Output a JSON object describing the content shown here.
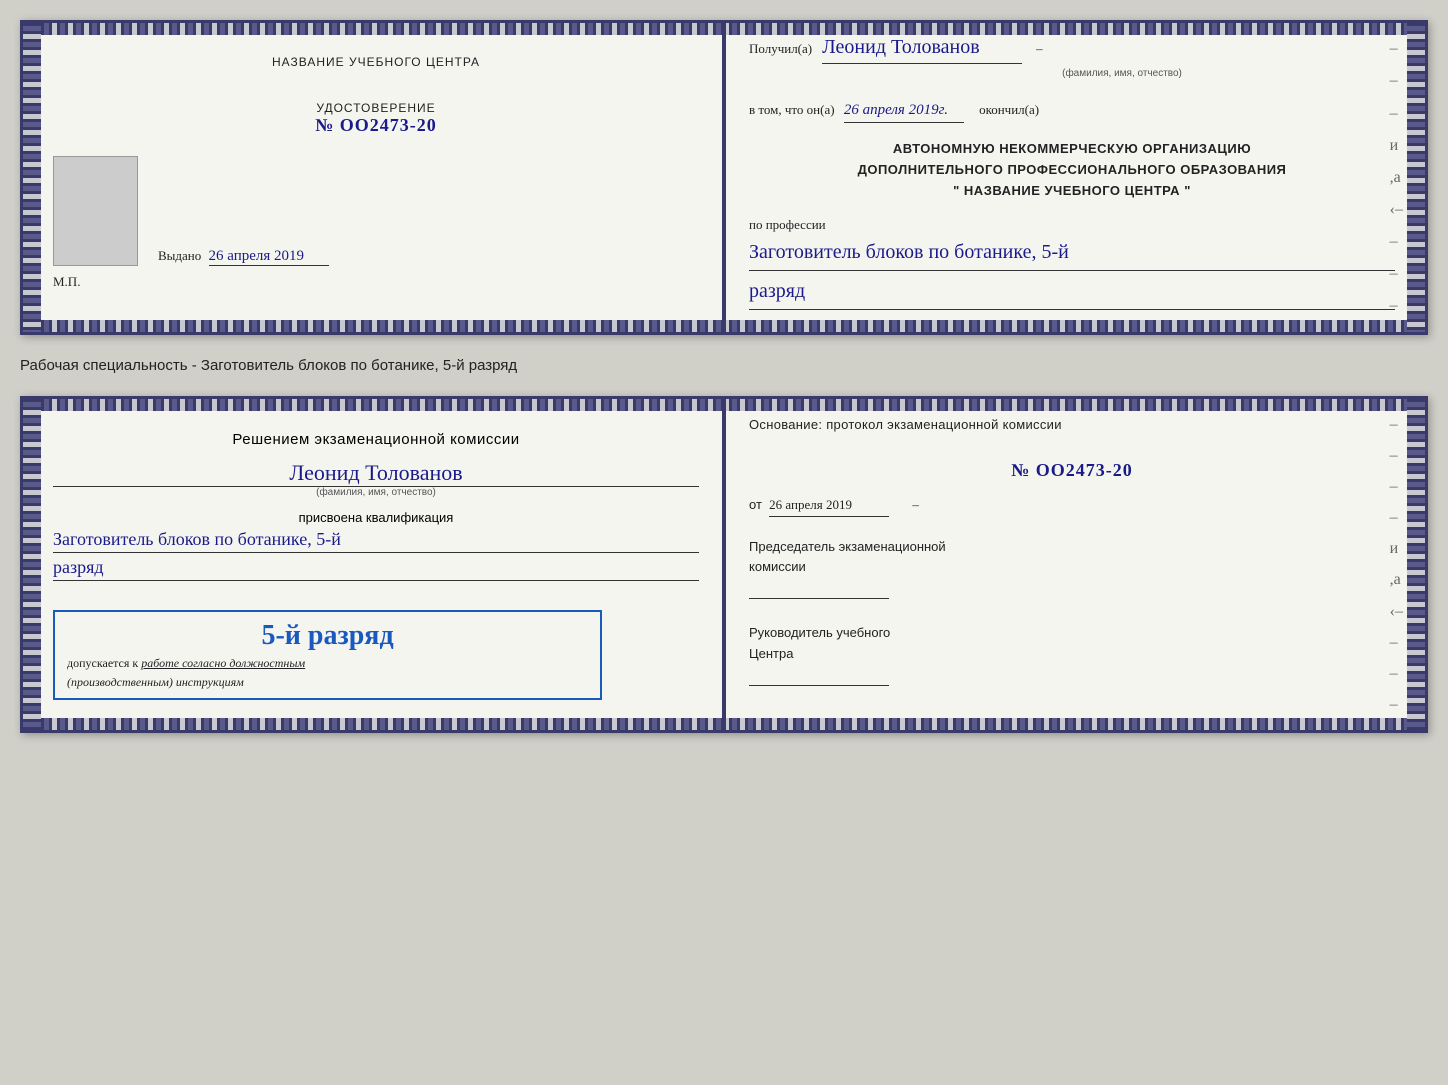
{
  "doc1": {
    "left": {
      "header": "НАЗВАНИЕ УЧЕБНОГО ЦЕНТРА",
      "cert_label": "УДОСТОВЕРЕНИЕ",
      "cert_number": "№ OO2473-20",
      "vydano_label": "Выдано",
      "vydano_date": "26 апреля 2019",
      "mp_label": "М.П."
    },
    "right": {
      "poluchil_label": "Получил(а)",
      "recipient_name": "Леонид Толованов",
      "fio_subtitle": "(фамилия, имя, отчество)",
      "vtom_label": "в том, что он(а)",
      "vtom_date": "26 апреля 2019г.",
      "okonchil_label": "окончил(а)",
      "org_line1": "АВТОНОМНУЮ НЕКОММЕРЧЕСКУЮ ОРГАНИЗАЦИЮ",
      "org_line2": "ДОПОЛНИТЕЛЬНОГО ПРОФЕССИОНАЛЬНОГО ОБРАЗОВАНИЯ",
      "org_quote1": "\"",
      "org_name": "НАЗВАНИЕ УЧЕБНОГО ЦЕНТРА",
      "org_quote2": "\"",
      "po_professii": "по профессии",
      "profession": "Заготовитель блоков по ботанике, 5-й",
      "razryad": "разряд"
    }
  },
  "specialty_label": "Рабочая специальность - Заготовитель блоков по ботанике, 5-й разряд",
  "doc2": {
    "left": {
      "resheniem_label": "Решением экзаменационной комиссии",
      "recipient_name": "Леонид Толованов",
      "fio_subtitle": "(фамилия, имя, отчество)",
      "prisvoena_label": "присвоена квалификация",
      "qualification": "Заготовитель блоков по ботанике, 5-й",
      "razryad": "разряд",
      "grade_big": "5-й разряд",
      "dopuskaetsya_label": "допускается к",
      "dopuskaetsya_text": "работе согласно должностным",
      "instruktsii_text": "(производственным) инструкциям"
    },
    "right": {
      "osnование_label": "Основание: протокол экзаменационной комиссии",
      "protocol_number": "№  OO2473-20",
      "ot_label": "от",
      "ot_date": "26 апреля 2019",
      "predsedatel_label": "Председатель экзаменационной",
      "predsedatel_label2": "комиссии",
      "rukovoditel_label": "Руководитель учебного",
      "rukovoditel_label2": "Центра"
    }
  }
}
